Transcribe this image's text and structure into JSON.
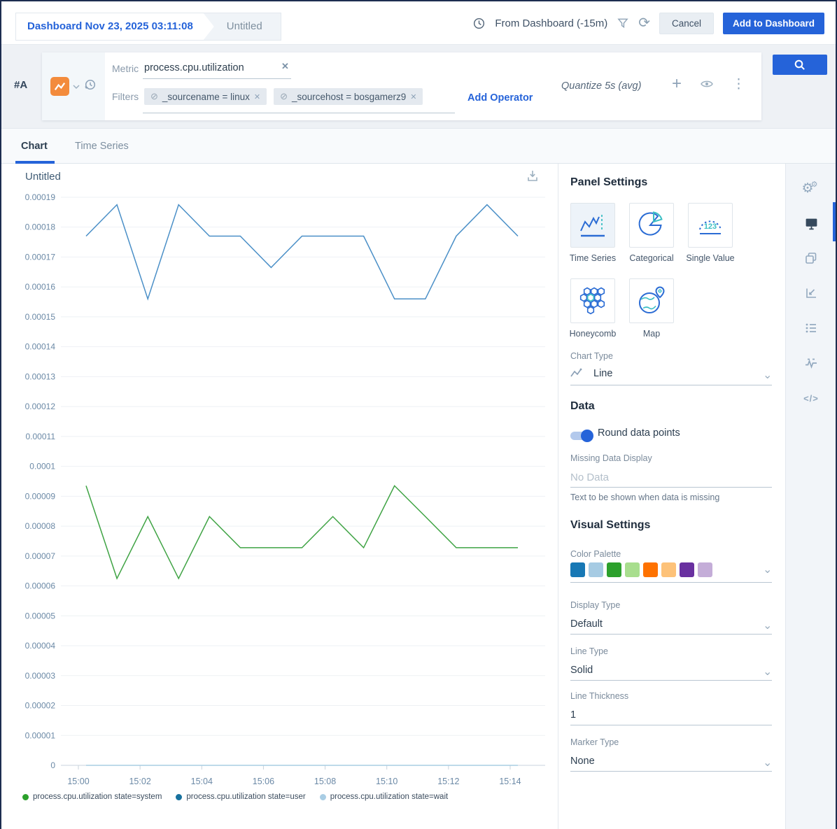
{
  "colors": {
    "accent": "#2563d9"
  },
  "topbar": {
    "breadcrumb_dashboard": "Dashboard Nov 23, 2025 03:11:08",
    "breadcrumb_panel": "Untitled",
    "time_range_label": "From Dashboard (-15m)",
    "cancel_label": "Cancel",
    "add_label": "Add to Dashboard"
  },
  "query": {
    "row_label": "#A",
    "metric_label": "Metric",
    "metric_value": "process.cpu.utilization",
    "filters_label": "Filters",
    "filters": [
      {
        "text": "_sourcename = linux"
      },
      {
        "text": "_sourcehost = bosgamerz9"
      }
    ],
    "add_operator_label": "Add Operator",
    "quantize_label": "Quantize 5s (avg)"
  },
  "tabs": {
    "chart": "Chart",
    "time_series": "Time Series"
  },
  "chart_data": {
    "type": "line",
    "title": "Untitled",
    "xlabel": "",
    "ylabel": "",
    "grid": "horizontal",
    "legend_position": "bottom",
    "ylim": [
      0,
      0.00019
    ],
    "y_tick_step": 1e-05,
    "y_tick_labels": [
      "0",
      "0.00001",
      "0.00002",
      "0.00003",
      "0.00004",
      "0.00005",
      "0.00006",
      "0.00007",
      "0.00008",
      "0.00009",
      "0.0001",
      "0.00011",
      "0.00012",
      "0.00013",
      "0.00014",
      "0.00015",
      "0.00016",
      "0.00017",
      "0.00018",
      "0.00019"
    ],
    "x_ticks": [
      "15:00",
      "15:02",
      "15:04",
      "15:06",
      "15:08",
      "15:10",
      "15:12",
      "15:14"
    ],
    "x_minutes": [
      0.25,
      1.25,
      2.25,
      3.25,
      4.25,
      5.25,
      6.25,
      7.25,
      8.25,
      9.25,
      10.25,
      11.25,
      12.25,
      13.25,
      14.25
    ],
    "series": [
      {
        "name": "process.cpu.utilization state=system",
        "color": "#3fa344",
        "dot": "#2ca02c",
        "values": [
          9.35e-05,
          6.25e-05,
          8.32e-05,
          6.25e-05,
          8.32e-05,
          7.28e-05,
          7.28e-05,
          7.28e-05,
          8.32e-05,
          7.28e-05,
          9.35e-05,
          8.32e-05,
          7.28e-05,
          7.28e-05,
          7.28e-05
        ]
      },
      {
        "name": "process.cpu.utilization state=user",
        "color": "#4a8fc7",
        "dot": "#17719e",
        "values": [
          0.000177,
          0.0001875,
          0.000156,
          0.0001875,
          0.000177,
          0.000177,
          0.0001665,
          0.000177,
          0.000177,
          0.000177,
          0.000156,
          0.000156,
          0.000177,
          0.0001875,
          0.000177
        ]
      },
      {
        "name": "process.cpu.utilization state=wait",
        "color": "#a9cde4",
        "dot": "#a9cde4",
        "values": [
          0,
          0,
          0,
          0,
          0,
          0,
          0,
          0,
          0,
          0,
          0,
          0,
          0,
          0,
          0
        ]
      }
    ]
  },
  "panel": {
    "title": "Panel Settings",
    "tiles": [
      {
        "label": "Time Series"
      },
      {
        "label": "Categorical"
      },
      {
        "label": "Single Value"
      },
      {
        "label": "Honeycomb"
      },
      {
        "label": "Map"
      }
    ],
    "chart_type_label": "Chart Type",
    "chart_type_value": "Line",
    "data_title": "Data",
    "round_toggle_label": "Round data points",
    "round_toggle_on": true,
    "missing_label": "Missing Data Display",
    "missing_placeholder": "No Data",
    "missing_help": "Text to be shown when data is missing",
    "visual_title": "Visual Settings",
    "palette_label": "Color Palette",
    "palette": [
      "#1778b5",
      "#a6cbe3",
      "#2ca02c",
      "#a8de8e",
      "#fe7201",
      "#fdc279",
      "#6930a0",
      "#c4add8"
    ],
    "display_type_label": "Display Type",
    "display_type_value": "Default",
    "line_type_label": "Line Type",
    "line_type_value": "Solid",
    "line_thickness_label": "Line Thickness",
    "line_thickness_value": "1",
    "marker_type_label": "Marker Type",
    "marker_type_value": "None"
  }
}
